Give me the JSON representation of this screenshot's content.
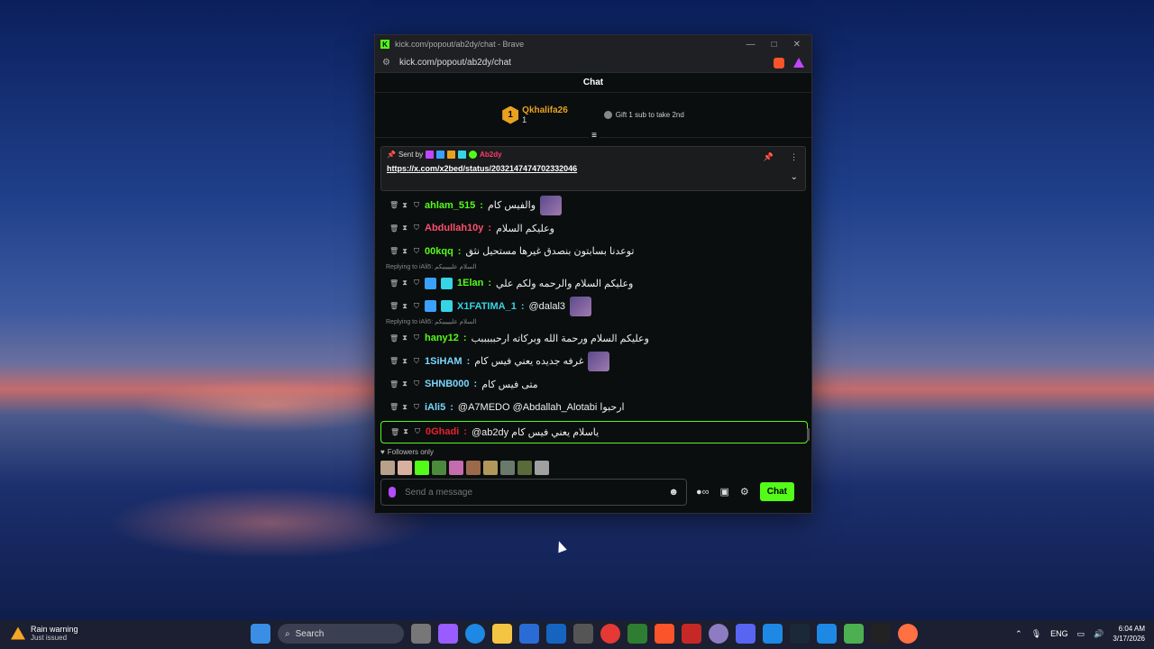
{
  "window": {
    "title": "kick.com/popout/ab2dy/chat - Brave",
    "url": "kick.com/popout/ab2dy/chat",
    "kick_logo": "K"
  },
  "chat": {
    "header": "Chat",
    "leaderboard": {
      "rank": "1",
      "username": "Qkhalifa26",
      "count": "1",
      "gift_text": "Gift 1 sub to take 2nd"
    },
    "pinned": {
      "sent_by_label": "Sent by",
      "sender": "Ab2dy",
      "link": "https://x.com/x2bed/status/2032147474702332046"
    },
    "messages": [
      {
        "user": "ahlam_515",
        "color": "g",
        "text": "والفيس كام",
        "emote": true
      },
      {
        "user": "Abdullah10y",
        "color": "r",
        "text": "وعليكم السلام"
      },
      {
        "user": "00kqq",
        "color": "g",
        "text": "توعدنا بسابتون بنصدق غيرها مستحيل نثق"
      },
      {
        "reply": "Replying to iAli5: السلام عليييييكم"
      },
      {
        "user": "1Elan",
        "color": "g",
        "text": "وعليكم السلام والرحمه ولكم علي",
        "badges": true
      },
      {
        "user": "X1FATIMA_1",
        "color": "c",
        "text": "@dalal3",
        "badges": true,
        "emote": true
      },
      {
        "reply": "Replying to iAli5: السلام عليييييكم"
      },
      {
        "user": "hany12",
        "color": "g",
        "text": "وعليكم السلام ورحمة الله وبركاته ارحبببببب"
      },
      {
        "user": "1SiHAM",
        "color": "b",
        "text": "غرفه جديده يعني فيس كام",
        "emote": true
      },
      {
        "user": "SHNB000",
        "color": "b",
        "text": "متى فيس كام"
      },
      {
        "user": "iAli5",
        "color": "b",
        "text": "@A7MEDO @Abdallah_Alotabi ارحبوا"
      },
      {
        "user": "0Ghadi",
        "color": "red2",
        "text": "@ab2dy ياسلام يعني فيس كام",
        "highlight": true
      }
    ],
    "followers_label": "Followers only",
    "input_placeholder": "Send a message",
    "chat_button": "Chat"
  },
  "taskbar": {
    "weather_title": "Rain warning",
    "weather_sub": "Just issued",
    "search_label": "Search",
    "lang": "ENG",
    "time": "6:04 AM",
    "date": "3/17/2026"
  }
}
